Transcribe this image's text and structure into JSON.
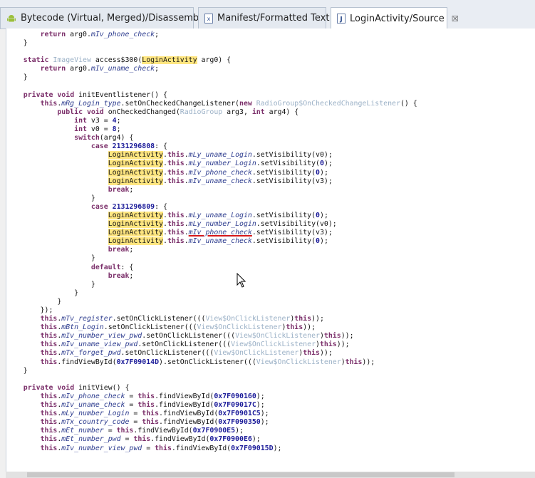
{
  "tabs": [
    {
      "label": "Bytecode (Virtual, Merged)/Disassembly",
      "icon": "android-icon",
      "active": false
    },
    {
      "label": "Manifest/Formatted Text",
      "icon": "xml-file-icon",
      "active": false
    },
    {
      "label": "LoginActivity/Source",
      "icon": "java-file-icon",
      "active": true,
      "close": "☒"
    }
  ],
  "colors": {
    "keyword": "#7b2f6a",
    "type": "#9ab0c6",
    "field": "#2e3d8f",
    "highlight": "#ffe680",
    "error_underline": "#d81818"
  },
  "code_lines": [
    [
      {
        "t": "        "
      },
      {
        "t": "return",
        "c": "kw"
      },
      {
        "t": " arg0."
      },
      {
        "t": "mIv_phone_check",
        "c": "fd"
      },
      {
        "t": ";"
      }
    ],
    [
      {
        "t": "    }"
      }
    ],
    [
      {
        "t": ""
      }
    ],
    [
      {
        "t": "    "
      },
      {
        "t": "static",
        "c": "kw"
      },
      {
        "t": " "
      },
      {
        "t": "ImageView",
        "c": "ty"
      },
      {
        "t": " access$300("
      },
      {
        "t": "LoginActivity",
        "c": "hl"
      },
      {
        "t": " arg0) {"
      }
    ],
    [
      {
        "t": "        "
      },
      {
        "t": "return",
        "c": "kw"
      },
      {
        "t": " arg0."
      },
      {
        "t": "mIv_uname_check",
        "c": "fd"
      },
      {
        "t": ";"
      }
    ],
    [
      {
        "t": "    }"
      }
    ],
    [
      {
        "t": ""
      }
    ],
    [
      {
        "t": "    "
      },
      {
        "t": "private",
        "c": "kw"
      },
      {
        "t": " "
      },
      {
        "t": "void",
        "c": "kw"
      },
      {
        "t": " initEventlistener() {"
      }
    ],
    [
      {
        "t": "        "
      },
      {
        "t": "this",
        "c": "kw"
      },
      {
        "t": "."
      },
      {
        "t": "mRg_Login_type",
        "c": "fd"
      },
      {
        "t": ".setOnCheckedChangeListener("
      },
      {
        "t": "new",
        "c": "kw"
      },
      {
        "t": " "
      },
      {
        "t": "RadioGroup$OnCheckedChangeListener",
        "c": "ty"
      },
      {
        "t": "() {"
      }
    ],
    [
      {
        "t": "            "
      },
      {
        "t": "public",
        "c": "kw"
      },
      {
        "t": " "
      },
      {
        "t": "void",
        "c": "kw"
      },
      {
        "t": " onCheckedChanged("
      },
      {
        "t": "RadioGroup",
        "c": "ty"
      },
      {
        "t": " arg3, "
      },
      {
        "t": "int",
        "c": "kw"
      },
      {
        "t": " arg4) {"
      }
    ],
    [
      {
        "t": "                "
      },
      {
        "t": "int",
        "c": "kw"
      },
      {
        "t": " v3 = "
      },
      {
        "t": "4",
        "c": "nm"
      },
      {
        "t": ";"
      }
    ],
    [
      {
        "t": "                "
      },
      {
        "t": "int",
        "c": "kw"
      },
      {
        "t": " v0 = "
      },
      {
        "t": "8",
        "c": "nm"
      },
      {
        "t": ";"
      }
    ],
    [
      {
        "t": "                "
      },
      {
        "t": "switch",
        "c": "kw"
      },
      {
        "t": "(arg4) {"
      }
    ],
    [
      {
        "t": "                    "
      },
      {
        "t": "case",
        "c": "kw"
      },
      {
        "t": " "
      },
      {
        "t": "2131296808",
        "c": "nm"
      },
      {
        "t": ": {"
      }
    ],
    [
      {
        "t": "                        "
      },
      {
        "t": "LoginActivity",
        "c": "hl"
      },
      {
        "t": "."
      },
      {
        "t": "this",
        "c": "kw"
      },
      {
        "t": "."
      },
      {
        "t": "mLy_uname_Login",
        "c": "fd"
      },
      {
        "t": ".setVisibility(v0);"
      }
    ],
    [
      {
        "t": "                        "
      },
      {
        "t": "LoginActivity",
        "c": "hl"
      },
      {
        "t": "."
      },
      {
        "t": "this",
        "c": "kw"
      },
      {
        "t": "."
      },
      {
        "t": "mLy_number_Login",
        "c": "fd"
      },
      {
        "t": ".setVisibility("
      },
      {
        "t": "0",
        "c": "nm"
      },
      {
        "t": ");"
      }
    ],
    [
      {
        "t": "                        "
      },
      {
        "t": "LoginActivity",
        "c": "hl"
      },
      {
        "t": "."
      },
      {
        "t": "this",
        "c": "kw"
      },
      {
        "t": "."
      },
      {
        "t": "mIv_phone_check",
        "c": "fd"
      },
      {
        "t": ".setVisibility("
      },
      {
        "t": "0",
        "c": "nm"
      },
      {
        "t": ");"
      }
    ],
    [
      {
        "t": "                        "
      },
      {
        "t": "LoginActivity",
        "c": "hl"
      },
      {
        "t": "."
      },
      {
        "t": "this",
        "c": "kw"
      },
      {
        "t": "."
      },
      {
        "t": "mIv_uname_check",
        "c": "fd"
      },
      {
        "t": ".setVisibility(v3);"
      }
    ],
    [
      {
        "t": "                        "
      },
      {
        "t": "break",
        "c": "kw"
      },
      {
        "t": ";"
      }
    ],
    [
      {
        "t": "                    }"
      }
    ],
    [
      {
        "t": "                    "
      },
      {
        "t": "case",
        "c": "kw"
      },
      {
        "t": " "
      },
      {
        "t": "2131296809",
        "c": "nm"
      },
      {
        "t": ": {"
      }
    ],
    [
      {
        "t": "                        "
      },
      {
        "t": "LoginActivity",
        "c": "hl"
      },
      {
        "t": "."
      },
      {
        "t": "this",
        "c": "kw"
      },
      {
        "t": "."
      },
      {
        "t": "mLy_uname_Login",
        "c": "fd"
      },
      {
        "t": ".setVisibility("
      },
      {
        "t": "0",
        "c": "nm"
      },
      {
        "t": ");"
      }
    ],
    [
      {
        "t": "                        "
      },
      {
        "t": "LoginActivity",
        "c": "hl"
      },
      {
        "t": "."
      },
      {
        "t": "this",
        "c": "kw"
      },
      {
        "t": "."
      },
      {
        "t": "mLy_number_Login",
        "c": "fd"
      },
      {
        "t": ".setVisibility(v0);"
      }
    ],
    [
      {
        "t": "                        "
      },
      {
        "t": "LoginActivity",
        "c": "hl"
      },
      {
        "t": "."
      },
      {
        "t": "this",
        "c": "kw"
      },
      {
        "t": "."
      },
      {
        "t": "mIv_phone_check",
        "c": "fd ul"
      },
      {
        "t": ".setVisibility(v3);"
      }
    ],
    [
      {
        "t": "                        "
      },
      {
        "t": "LoginActivity",
        "c": "hl"
      },
      {
        "t": "."
      },
      {
        "t": "this",
        "c": "kw"
      },
      {
        "t": "."
      },
      {
        "t": "mIv_uname_check",
        "c": "fd"
      },
      {
        "t": ".setVisibility("
      },
      {
        "t": "0",
        "c": "nm"
      },
      {
        "t": ");"
      }
    ],
    [
      {
        "t": "                        "
      },
      {
        "t": "break",
        "c": "kw"
      },
      {
        "t": ";"
      }
    ],
    [
      {
        "t": "                    }"
      }
    ],
    [
      {
        "t": "                    "
      },
      {
        "t": "default",
        "c": "kw"
      },
      {
        "t": ": {"
      }
    ],
    [
      {
        "t": "                        "
      },
      {
        "t": "break",
        "c": "kw"
      },
      {
        "t": ";"
      }
    ],
    [
      {
        "t": "                    }"
      }
    ],
    [
      {
        "t": "                }"
      }
    ],
    [
      {
        "t": "            }"
      }
    ],
    [
      {
        "t": "        });"
      }
    ],
    [
      {
        "t": "        "
      },
      {
        "t": "this",
        "c": "kw"
      },
      {
        "t": "."
      },
      {
        "t": "mTv_register",
        "c": "fd"
      },
      {
        "t": ".setOnClickListener((("
      },
      {
        "t": "View$OnClickListener",
        "c": "ty"
      },
      {
        "t": ")"
      },
      {
        "t": "this",
        "c": "kw"
      },
      {
        "t": "));"
      }
    ],
    [
      {
        "t": "        "
      },
      {
        "t": "this",
        "c": "kw"
      },
      {
        "t": "."
      },
      {
        "t": "mBtn_Login",
        "c": "fd"
      },
      {
        "t": ".setOnClickListener((("
      },
      {
        "t": "View$OnClickListener",
        "c": "ty"
      },
      {
        "t": ")"
      },
      {
        "t": "this",
        "c": "kw"
      },
      {
        "t": "));"
      }
    ],
    [
      {
        "t": "        "
      },
      {
        "t": "this",
        "c": "kw"
      },
      {
        "t": "."
      },
      {
        "t": "mIv_number_view_pwd",
        "c": "fd"
      },
      {
        "t": ".setOnClickListener((("
      },
      {
        "t": "View$OnClickListener",
        "c": "ty"
      },
      {
        "t": ")"
      },
      {
        "t": "this",
        "c": "kw"
      },
      {
        "t": "));"
      }
    ],
    [
      {
        "t": "        "
      },
      {
        "t": "this",
        "c": "kw"
      },
      {
        "t": "."
      },
      {
        "t": "mIv_uname_view_pwd",
        "c": "fd"
      },
      {
        "t": ".setOnClickListener((("
      },
      {
        "t": "View$OnClickListener",
        "c": "ty"
      },
      {
        "t": ")"
      },
      {
        "t": "this",
        "c": "kw"
      },
      {
        "t": "));"
      }
    ],
    [
      {
        "t": "        "
      },
      {
        "t": "this",
        "c": "kw"
      },
      {
        "t": "."
      },
      {
        "t": "mTx_forget_pwd",
        "c": "fd"
      },
      {
        "t": ".setOnClickListener((("
      },
      {
        "t": "View$OnClickListener",
        "c": "ty"
      },
      {
        "t": ")"
      },
      {
        "t": "this",
        "c": "kw"
      },
      {
        "t": "));"
      }
    ],
    [
      {
        "t": "        "
      },
      {
        "t": "this",
        "c": "kw"
      },
      {
        "t": ".findViewById("
      },
      {
        "t": "0x7F09014D",
        "c": "nm"
      },
      {
        "t": ").setOnClickListener((("
      },
      {
        "t": "View$OnClickListener",
        "c": "ty"
      },
      {
        "t": ")"
      },
      {
        "t": "this",
        "c": "kw"
      },
      {
        "t": "));"
      }
    ],
    [
      {
        "t": "    }"
      }
    ],
    [
      {
        "t": ""
      }
    ],
    [
      {
        "t": "    "
      },
      {
        "t": "private",
        "c": "kw"
      },
      {
        "t": " "
      },
      {
        "t": "void",
        "c": "kw"
      },
      {
        "t": " initView() {"
      }
    ],
    [
      {
        "t": "        "
      },
      {
        "t": "this",
        "c": "kw"
      },
      {
        "t": "."
      },
      {
        "t": "mIv_phone_check",
        "c": "fd"
      },
      {
        "t": " = "
      },
      {
        "t": "this",
        "c": "kw"
      },
      {
        "t": ".findViewById("
      },
      {
        "t": "0x7F090160",
        "c": "nm"
      },
      {
        "t": ");"
      }
    ],
    [
      {
        "t": "        "
      },
      {
        "t": "this",
        "c": "kw"
      },
      {
        "t": "."
      },
      {
        "t": "mIv_uname_check",
        "c": "fd"
      },
      {
        "t": " = "
      },
      {
        "t": "this",
        "c": "kw"
      },
      {
        "t": ".findViewById("
      },
      {
        "t": "0x7F09017C",
        "c": "nm"
      },
      {
        "t": ");"
      }
    ],
    [
      {
        "t": "        "
      },
      {
        "t": "this",
        "c": "kw"
      },
      {
        "t": "."
      },
      {
        "t": "mLy_number_Login",
        "c": "fd"
      },
      {
        "t": " = "
      },
      {
        "t": "this",
        "c": "kw"
      },
      {
        "t": ".findViewById("
      },
      {
        "t": "0x7F0901C5",
        "c": "nm"
      },
      {
        "t": ");"
      }
    ],
    [
      {
        "t": "        "
      },
      {
        "t": "this",
        "c": "kw"
      },
      {
        "t": "."
      },
      {
        "t": "mTx_country_code",
        "c": "fd"
      },
      {
        "t": " = "
      },
      {
        "t": "this",
        "c": "kw"
      },
      {
        "t": ".findViewById("
      },
      {
        "t": "0x7F090350",
        "c": "nm"
      },
      {
        "t": ");"
      }
    ],
    [
      {
        "t": "        "
      },
      {
        "t": "this",
        "c": "kw"
      },
      {
        "t": "."
      },
      {
        "t": "mEt_number",
        "c": "fd"
      },
      {
        "t": " = "
      },
      {
        "t": "this",
        "c": "kw"
      },
      {
        "t": ".findViewById("
      },
      {
        "t": "0x7F0900E5",
        "c": "nm"
      },
      {
        "t": ");"
      }
    ],
    [
      {
        "t": "        "
      },
      {
        "t": "this",
        "c": "kw"
      },
      {
        "t": "."
      },
      {
        "t": "mEt_number_pwd",
        "c": "fd"
      },
      {
        "t": " = "
      },
      {
        "t": "this",
        "c": "kw"
      },
      {
        "t": ".findViewById("
      },
      {
        "t": "0x7F0900E6",
        "c": "nm"
      },
      {
        "t": ");"
      }
    ],
    [
      {
        "t": "        "
      },
      {
        "t": "this",
        "c": "kw"
      },
      {
        "t": "."
      },
      {
        "t": "mIv_number_view_pwd",
        "c": "fd"
      },
      {
        "t": " = "
      },
      {
        "t": "this",
        "c": "kw"
      },
      {
        "t": ".findViewById("
      },
      {
        "t": "0x7F09015D",
        "c": "nm"
      },
      {
        "t": ");"
      }
    ]
  ]
}
